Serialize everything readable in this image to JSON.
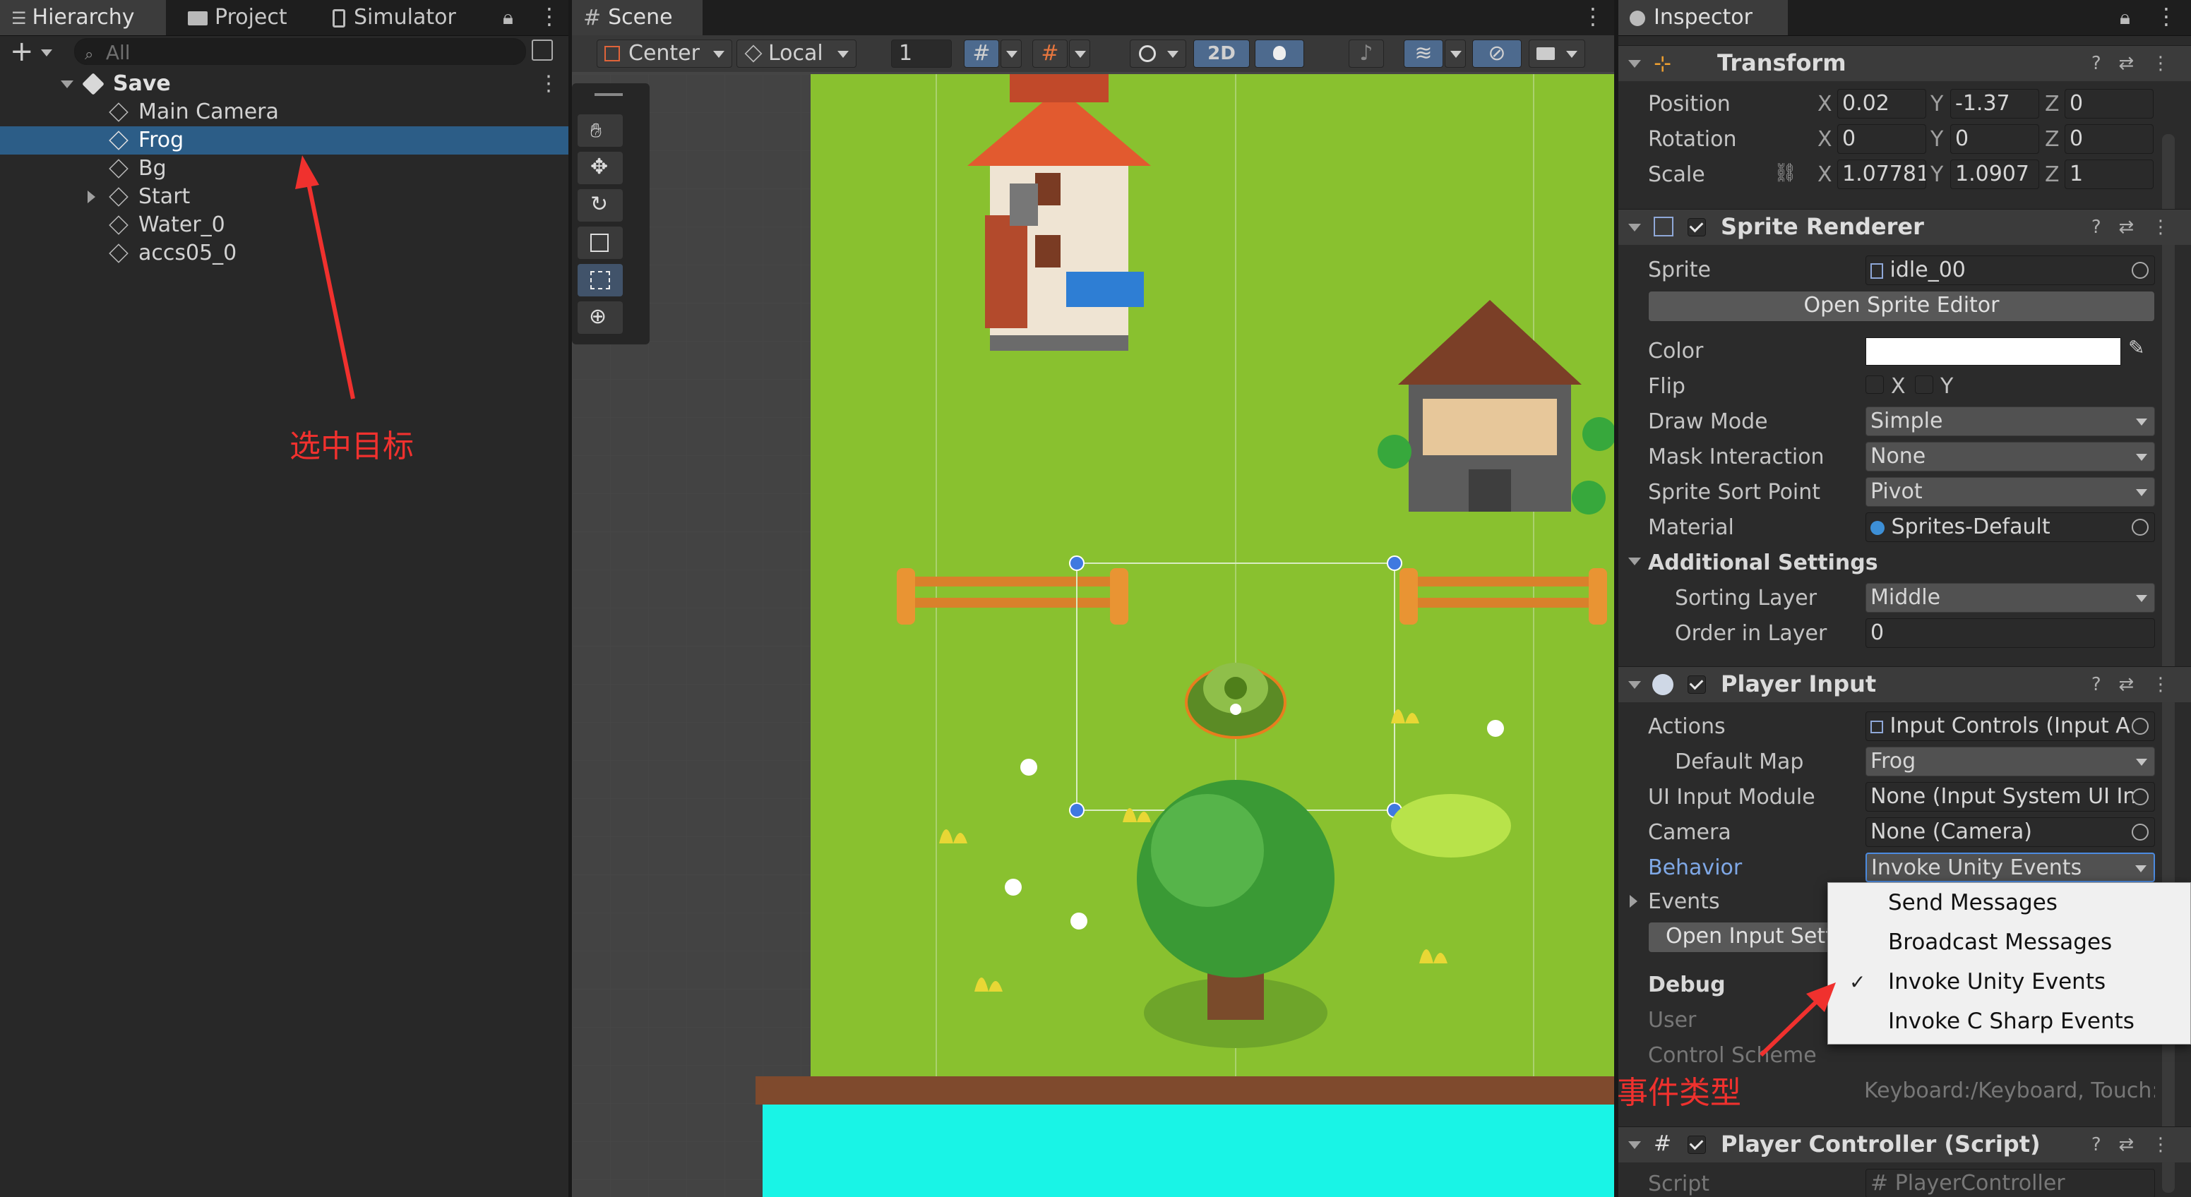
{
  "hierarchy": {
    "tabs": [
      {
        "label": "Hierarchy",
        "icon": "list-icon"
      },
      {
        "label": "Project",
        "icon": "folder-icon"
      },
      {
        "label": "Simulator",
        "icon": "device-icon"
      }
    ],
    "search_placeholder": "All",
    "scene_name": "Save",
    "items": [
      {
        "label": "Main Camera"
      },
      {
        "label": "Frog"
      },
      {
        "label": "Bg"
      },
      {
        "label": "Start"
      },
      {
        "label": "Water_0"
      },
      {
        "label": "accs05_0"
      }
    ],
    "selected_item": "Frog"
  },
  "scene": {
    "tab_label": "Scene",
    "pivot_mode": "Center",
    "pivot_rotation": "Local",
    "grid_snap_value": "1",
    "mode_2d": "2D"
  },
  "inspector": {
    "tab_label": "Inspector",
    "transform": {
      "title": "Transform",
      "position_label": "Position",
      "rotation_label": "Rotation",
      "scale_label": "Scale",
      "axis_x": "X",
      "axis_y": "Y",
      "axis_z": "Z",
      "position": {
        "x": "0.02",
        "y": "-1.37",
        "z": "0"
      },
      "rotation": {
        "x": "0",
        "y": "0",
        "z": "0"
      },
      "scale": {
        "x": "1.07781",
        "y": "1.0907",
        "z": "1"
      }
    },
    "sprite_renderer": {
      "title": "Sprite Renderer",
      "sprite_label": "Sprite",
      "sprite_value": "idle_00",
      "open_editor": "Open Sprite Editor",
      "color_label": "Color",
      "color_value": "#ffffff",
      "flip_label": "Flip",
      "flip_x": "X",
      "flip_y": "Y",
      "draw_mode_label": "Draw Mode",
      "draw_mode_value": "Simple",
      "mask_label": "Mask Interaction",
      "mask_value": "None",
      "sort_point_label": "Sprite Sort Point",
      "sort_point_value": "Pivot",
      "material_label": "Material",
      "material_value": "Sprites-Default",
      "additional_label": "Additional Settings",
      "sorting_layer_label": "Sorting Layer",
      "sorting_layer_value": "Middle",
      "order_label": "Order in Layer",
      "order_value": "0"
    },
    "player_input": {
      "title": "Player Input",
      "actions_label": "Actions",
      "actions_value": "Input Controls (Input A",
      "default_map_label": "Default Map",
      "default_map_value": "Frog",
      "ui_module_label": "UI Input Module",
      "ui_module_value": "None (Input System UI In",
      "camera_label": "Camera",
      "camera_value": "None (Camera)",
      "behavior_label": "Behavior",
      "behavior_value": "Invoke Unity Events",
      "events_label": "Events",
      "open_settings": "Open Input Sett",
      "debug_label": "Debug",
      "user_label": "User",
      "control_scheme_label": "Control Scheme",
      "devices_value": "Keyboard:/Keyboard, Touch:"
    },
    "player_controller": {
      "title": "Player Controller (Script)",
      "script_label": "Script",
      "script_value": "PlayerController"
    }
  },
  "behavior_menu": {
    "options": [
      "Send Messages",
      "Broadcast Messages",
      "Invoke Unity Events",
      "Invoke C Sharp Events"
    ],
    "checked": "Invoke Unity Events"
  },
  "annotations": {
    "select_target": "选中目标",
    "event_type": "事件类型",
    "color": "#f0312e"
  }
}
